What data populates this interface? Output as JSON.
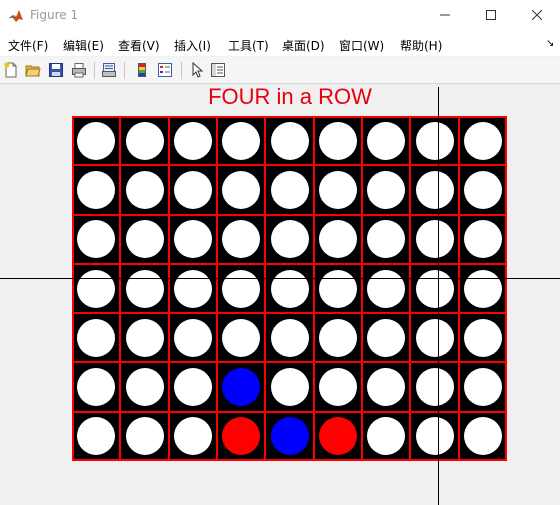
{
  "window": {
    "title": "Figure 1",
    "icon": "matlab-icon",
    "controls": [
      "minimize-icon",
      "maximize-icon",
      "close-icon"
    ]
  },
  "menu": {
    "items": [
      "文件(F)",
      "编辑(E)",
      "查看(V)",
      "插入(I)",
      "工具(T)",
      "桌面(D)",
      "窗口(W)",
      "帮助(H)"
    ],
    "overflow_glyph": "↘"
  },
  "toolbar": {
    "buttons": [
      "new-figure-icon",
      "open-file-icon",
      "save-icon",
      "print-icon",
      "print-preview-icon",
      "colorbar-icon",
      "legend-icon",
      "edit-pointer-icon",
      "property-inspector-icon"
    ]
  },
  "game": {
    "title": "FOUR in a ROW",
    "columns": 9,
    "rows": 7,
    "cells": [
      [
        "W",
        "W",
        "W",
        "W",
        "W",
        "W",
        "W",
        "W",
        "W"
      ],
      [
        "W",
        "W",
        "W",
        "W",
        "W",
        "W",
        "W",
        "W",
        "W"
      ],
      [
        "W",
        "W",
        "W",
        "W",
        "W",
        "W",
        "W",
        "W",
        "W"
      ],
      [
        "W",
        "W",
        "W",
        "W",
        "W",
        "W",
        "W",
        "W",
        "W"
      ],
      [
        "W",
        "W",
        "W",
        "W",
        "W",
        "W",
        "W",
        "W",
        "W"
      ],
      [
        "W",
        "W",
        "W",
        "B",
        "W",
        "W",
        "W",
        "W",
        "W"
      ],
      [
        "W",
        "W",
        "W",
        "R",
        "B",
        "R",
        "W",
        "W",
        "W"
      ]
    ],
    "colors": {
      "W": "#ffffff",
      "B": "#0000ff",
      "R": "#ff0000",
      "grid": "#ff0000",
      "board": "#000000",
      "title": "#e8000e"
    }
  }
}
